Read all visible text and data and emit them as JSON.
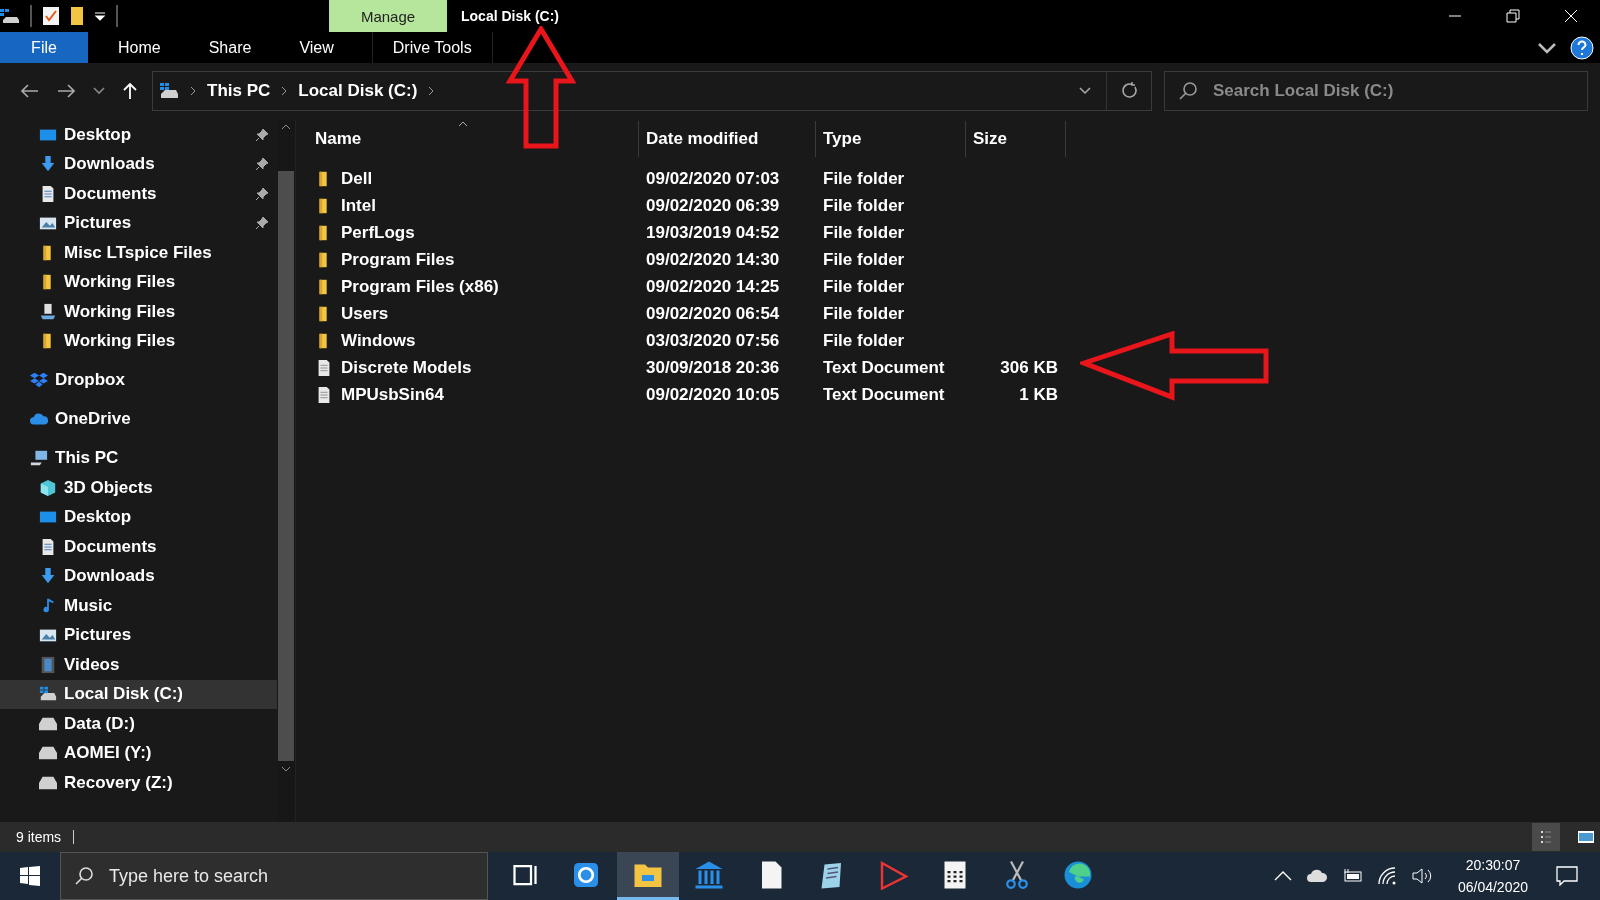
{
  "window": {
    "title": "Local Disk (C:)",
    "contextual_group": "Manage"
  },
  "ribbon": {
    "tabs": [
      {
        "label": "File",
        "kind": "file",
        "selected": false
      },
      {
        "label": "Home",
        "kind": "tab",
        "selected": false
      },
      {
        "label": "Share",
        "kind": "tab",
        "selected": false
      },
      {
        "label": "View",
        "kind": "tab",
        "selected": false
      },
      {
        "label": "Drive Tools",
        "kind": "contextual",
        "selected": false
      }
    ]
  },
  "address_bar": {
    "breadcrumbs": [
      "This PC",
      "Local Disk (C:)"
    ]
  },
  "search": {
    "placeholder": "Search Local Disk (C:)"
  },
  "sidebar": {
    "quick_access": [
      {
        "label": "Desktop",
        "kind": "desktop",
        "pinned": true,
        "selected": false
      },
      {
        "label": "Downloads",
        "kind": "download",
        "pinned": true,
        "selected": false
      },
      {
        "label": "Documents",
        "kind": "document",
        "pinned": true,
        "selected": false
      },
      {
        "label": "Pictures",
        "kind": "pictures",
        "pinned": true,
        "selected": false
      },
      {
        "label": "Misc LTspice Files",
        "kind": "folder",
        "pinned": false,
        "selected": false
      },
      {
        "label": "Working Files",
        "kind": "folder",
        "pinned": false,
        "selected": false
      },
      {
        "label": "Working Files",
        "kind": "network",
        "pinned": false,
        "selected": false
      },
      {
        "label": "Working Files",
        "kind": "folder",
        "pinned": false,
        "selected": false
      }
    ],
    "items": [
      {
        "label": "Dropbox",
        "kind": "dropbox",
        "selected": false
      },
      {
        "label": "OneDrive",
        "kind": "cloud",
        "selected": false
      },
      {
        "label": "This PC",
        "kind": "computer",
        "selected": false,
        "children": [
          {
            "label": "3D Objects",
            "kind": "cube",
            "selected": false
          },
          {
            "label": "Desktop",
            "kind": "desktop",
            "selected": false
          },
          {
            "label": "Documents",
            "kind": "document",
            "selected": false
          },
          {
            "label": "Downloads",
            "kind": "download",
            "selected": false
          },
          {
            "label": "Music",
            "kind": "music",
            "selected": false
          },
          {
            "label": "Pictures",
            "kind": "pictures",
            "selected": false
          },
          {
            "label": "Videos",
            "kind": "video",
            "selected": false
          },
          {
            "label": "Local Disk (C:)",
            "kind": "windrive",
            "selected": true
          },
          {
            "label": "Data (D:)",
            "kind": "drive",
            "selected": false
          },
          {
            "label": "AOMEI (Y:)",
            "kind": "drive",
            "selected": false
          },
          {
            "label": "Recovery (Z:)",
            "kind": "drive",
            "selected": false
          }
        ]
      }
    ]
  },
  "table": {
    "columns": [
      {
        "label": "Name",
        "sorted": true
      },
      {
        "label": "Date modified",
        "sorted": false
      },
      {
        "label": "Type",
        "sorted": false
      },
      {
        "label": "Size",
        "sorted": false
      }
    ],
    "rows": [
      {
        "kind": "folder",
        "name": "Dell",
        "date": "09/02/2020 07:03",
        "type": "File folder"
      },
      {
        "kind": "folder",
        "name": "Intel",
        "date": "09/02/2020 06:39",
        "type": "File folder"
      },
      {
        "kind": "folder",
        "name": "PerfLogs",
        "date": "19/03/2019 04:52",
        "type": "File folder"
      },
      {
        "kind": "folder",
        "name": "Program Files",
        "date": "09/02/2020 14:30",
        "type": "File folder"
      },
      {
        "kind": "folder",
        "name": "Program Files (x86)",
        "date": "09/02/2020 14:25",
        "type": "File folder"
      },
      {
        "kind": "folder",
        "name": "Users",
        "date": "09/02/2020 06:54",
        "type": "File folder"
      },
      {
        "kind": "folder",
        "name": "Windows",
        "date": "03/03/2020 07:56",
        "type": "File folder"
      },
      {
        "kind": "textfile",
        "name": "Discrete Models",
        "date": "30/09/2018 20:36",
        "type": "Text Document",
        "size": "306 KB"
      },
      {
        "kind": "textfile",
        "name": "MPUsbSin64",
        "date": "09/02/2020 10:05",
        "type": "Text Document",
        "size": "1 KB"
      }
    ]
  },
  "status_bar": {
    "item_count": "9 items",
    "views": [
      {
        "kind": "details",
        "selected": true
      },
      {
        "kind": "tiles",
        "selected": false
      }
    ]
  },
  "taskbar": {
    "search": {
      "placeholder": "Type here to search"
    },
    "apps": [
      {
        "kind": "taskview",
        "active": false
      },
      {
        "kind": "sync",
        "active": false
      },
      {
        "kind": "explorer",
        "active": true
      },
      {
        "kind": "bank",
        "active": false
      },
      {
        "kind": "page",
        "active": false
      },
      {
        "kind": "notepad",
        "active": false
      },
      {
        "kind": "ltspice",
        "active": false
      },
      {
        "kind": "calculator",
        "active": false
      },
      {
        "kind": "scissors",
        "active": false
      },
      {
        "kind": "edge",
        "active": false
      }
    ],
    "time": "20:30:07",
    "date": "06/04/2020"
  }
}
